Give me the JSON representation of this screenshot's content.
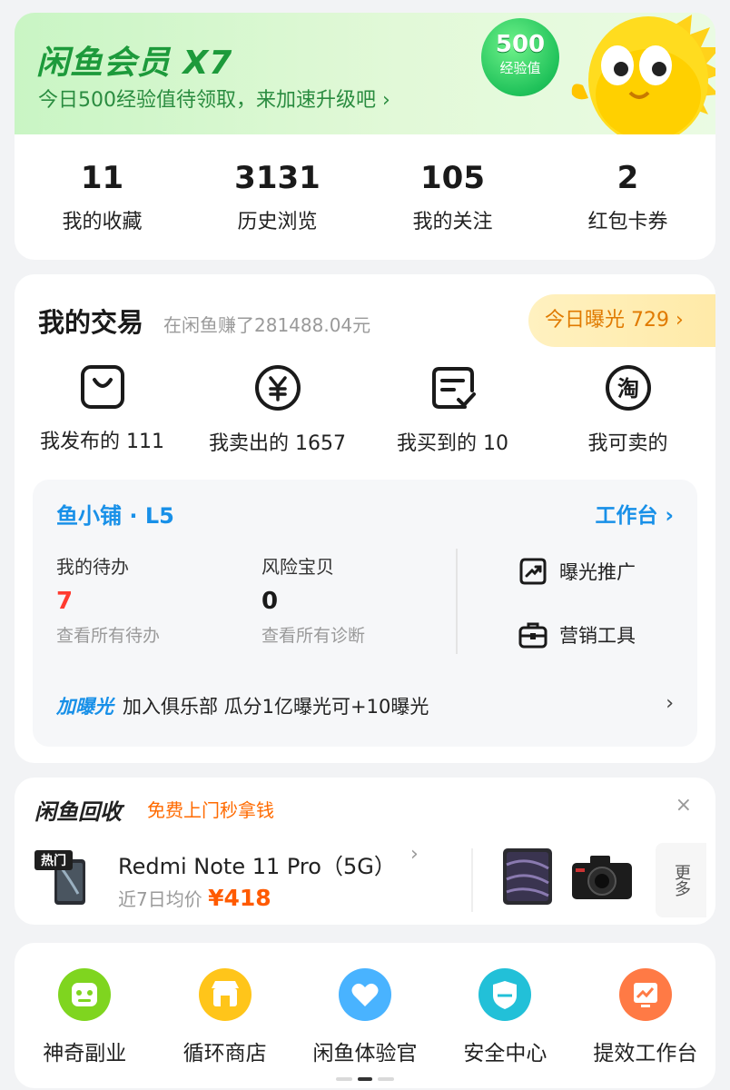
{
  "member": {
    "title": "闲鱼会员 X7",
    "subtitle": "今日500经验值待领取，来加速升级吧 ›",
    "exp_value": "500",
    "exp_label": "经验值"
  },
  "stats": [
    {
      "value": "11",
      "label": "我的收藏"
    },
    {
      "value": "3131",
      "label": "历史浏览"
    },
    {
      "value": "105",
      "label": "我的关注"
    },
    {
      "value": "2",
      "label": "红包卡券"
    }
  ],
  "trade": {
    "title": "我的交易",
    "earned": "在闲鱼赚了281488.04元",
    "exposure": "今日曝光 729 ›",
    "items": [
      {
        "label": "我发布的 111",
        "icon": "bag-icon"
      },
      {
        "label": "我卖出的 1657",
        "icon": "yen-icon"
      },
      {
        "label": "我买到的 10",
        "icon": "order-check-icon"
      },
      {
        "label": "我可卖的",
        "icon": "tao-icon"
      }
    ]
  },
  "shop": {
    "title": "鱼小铺 · L5",
    "workbench": "工作台 ›",
    "todo_title": "我的待办",
    "todo_count": "7",
    "todo_link": "查看所有待办",
    "risk_title": "风险宝贝",
    "risk_count": "0",
    "risk_link": "查看所有诊断",
    "tool_promote": "曝光推广",
    "tool_marketing": "营销工具",
    "club_tag": "加曝光",
    "club_text": "加入俱乐部 瓜分1亿曝光可+10曝光",
    "club_arrow": "›"
  },
  "recycle": {
    "title": "闲鱼回收",
    "subtitle": "免费上门秒拿钱",
    "close": "×",
    "hot_label": "热门",
    "product": "Redmi Note 11 Pro（5G）",
    "chevron": "›",
    "price_label": "近7日均价",
    "price": "¥418",
    "more": "更多"
  },
  "services": [
    {
      "label": "神奇副业",
      "color": "#7fd51f",
      "icon": "robot-icon"
    },
    {
      "label": "循环商店",
      "color": "#ffc51a",
      "icon": "store-icon"
    },
    {
      "label": "闲鱼体验官",
      "color": "#49b3ff",
      "icon": "heart-icon"
    },
    {
      "label": "安全中心",
      "color": "#22c0d8",
      "icon": "shield-icon"
    },
    {
      "label": "提效工作台",
      "color": "#ff7a45",
      "icon": "chart-icon"
    }
  ],
  "colors": {
    "brand_green": "#1d9a3b",
    "accent_blue": "#1890e8",
    "accent_orange": "#ff5a00",
    "todo_red": "#ff3b30"
  }
}
